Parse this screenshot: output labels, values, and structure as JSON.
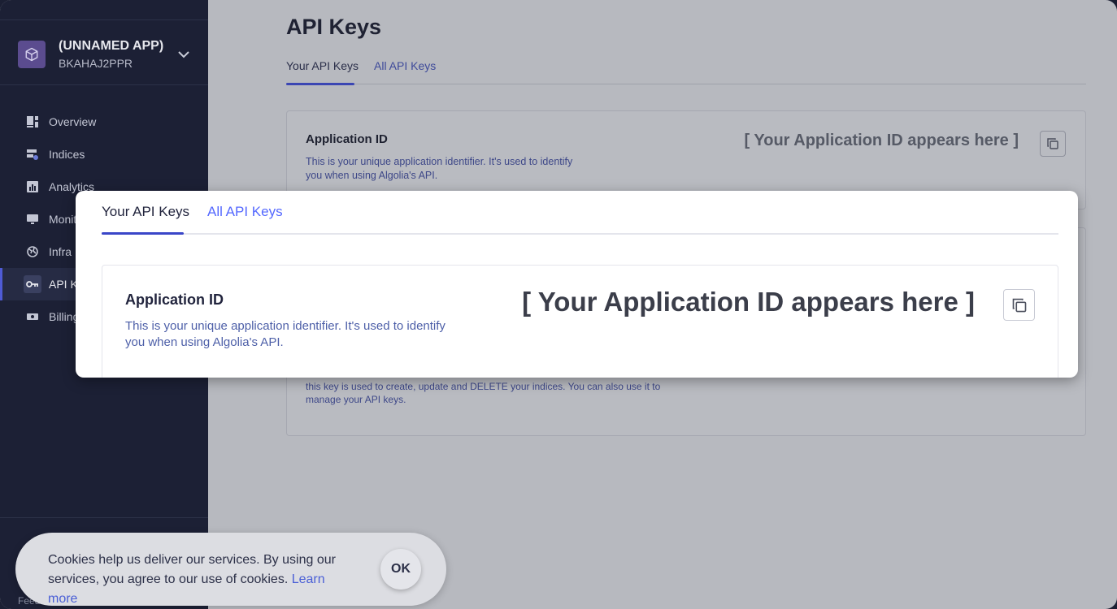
{
  "app": {
    "name": "(UNNAMED APP)",
    "id": "BKAHAJ2PPR"
  },
  "sidebar": {
    "items": [
      {
        "label": "Overview",
        "icon": "dashboard-icon"
      },
      {
        "label": "Indices",
        "icon": "indices-icon"
      },
      {
        "label": "Analytics",
        "icon": "analytics-icon"
      },
      {
        "label": "Monit",
        "icon": "monitor-icon"
      },
      {
        "label": "Infra",
        "icon": "globe-icon"
      },
      {
        "label": "API K",
        "icon": "key-icon",
        "active": true
      },
      {
        "label": "Billing",
        "icon": "billing-icon"
      }
    ],
    "footer_text": "Feed"
  },
  "page": {
    "title": "API Keys",
    "tabs": [
      {
        "label": "Your API Keys",
        "active": true
      },
      {
        "label": "All API Keys"
      }
    ],
    "application_id": {
      "label": "Application ID",
      "description": "This is your unique application identifier. It's used to identify you when using Algolia's API.",
      "value": "[ Your Application ID appears here ]"
    },
    "admin_key_description": "this key is used to create, update and DELETE your indices. You can also use it to manage your API keys."
  },
  "cookie": {
    "text": "Cookies help us deliver our services. By using our services, you agree to our use of cookies.",
    "learn_more": "Learn more",
    "ok_label": "OK"
  },
  "colors": {
    "sidebar_bg": "#1c2035",
    "accent": "#5468ff",
    "tab_underline": "#3a46c8"
  }
}
